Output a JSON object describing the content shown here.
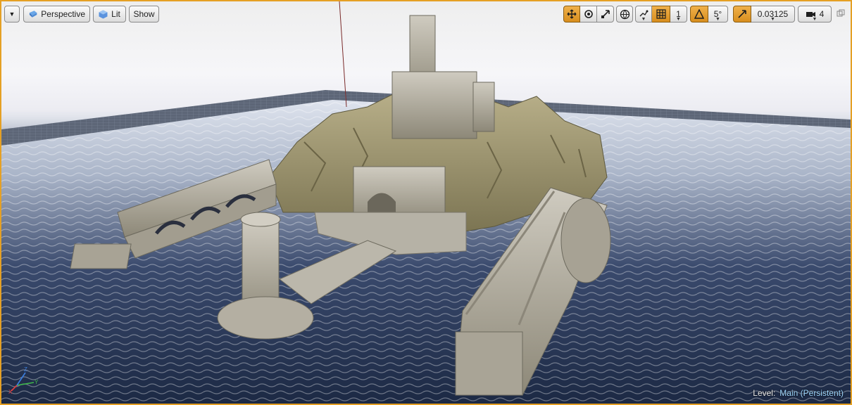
{
  "toolbar": {
    "options_menu_icon": "chevron-down-icon",
    "perspective_label": "Perspective",
    "lit_label": "Lit",
    "show_label": "Show",
    "grid_snap_value": "1",
    "rotation_snap_value": "5°",
    "scale_snap_value": "0.03125",
    "camera_speed_value": "4",
    "transform_tools": [
      "translate-icon",
      "rotate-icon",
      "scale-icon"
    ],
    "accent_color": "#e5a024"
  },
  "status": {
    "level_label": "Level:",
    "level_value": "Main (Persistent)"
  },
  "gizmo": {
    "x_label": "X",
    "y_label": "Y",
    "z_label": "Z"
  }
}
